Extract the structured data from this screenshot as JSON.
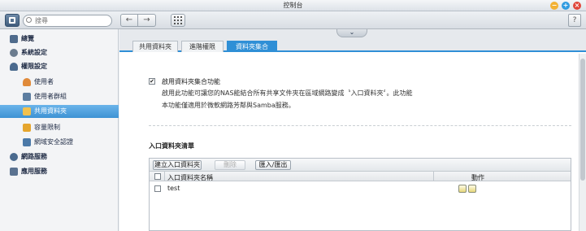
{
  "window": {
    "title": "控制台",
    "colors": {
      "minimize": "#f2b134",
      "maximize": "#2f9be0",
      "close": "#e0463a"
    }
  },
  "toolbar": {
    "search_placeholder": "搜尋",
    "back_icon": "←",
    "forward_icon": "→",
    "apps_icon": "grid-icon",
    "help_label": "?"
  },
  "sidebar": {
    "items": [
      {
        "label": "總覽",
        "icon": "overview-icon",
        "level": 1
      },
      {
        "label": "系統設定",
        "icon": "gear-icon",
        "level": 1
      },
      {
        "label": "權限設定",
        "icon": "user-icon",
        "level": 1
      },
      {
        "label": "使用者",
        "icon": "person-icon",
        "level": 2
      },
      {
        "label": "使用者群組",
        "icon": "group-icon",
        "level": 2
      },
      {
        "label": "共用資料夾",
        "icon": "folder-icon",
        "level": 2,
        "active": true
      },
      {
        "label": "容量限制",
        "icon": "quota-icon",
        "level": 2
      },
      {
        "label": "網域安全認證",
        "icon": "domain-icon",
        "level": 2
      },
      {
        "label": "網路服務",
        "icon": "globe-icon",
        "level": 1
      },
      {
        "label": "應用服務",
        "icon": "app-icon",
        "level": 1
      }
    ]
  },
  "tabs": [
    {
      "label": "共用資料夾"
    },
    {
      "label": "進階權限"
    },
    {
      "label": "資料夾集合",
      "active": true
    }
  ],
  "content": {
    "enable_label": "啟用資料夾集合功能",
    "enable_checked": true,
    "description_1": "啟用此功能可讓您的NAS能結合所有共享文件夾在區域網路變成〝入口資料夾〞。此功能",
    "description_2": "本功能僅適用於微軟網路芳鄰與Samba服務。",
    "list_title": "入口資料夾清單",
    "buttons": {
      "create": "建立入口資料夾",
      "delete": "刪除",
      "import_export": "匯入/匯出"
    },
    "columns": {
      "name": "入口資料夾名稱",
      "action": "動作"
    },
    "rows": [
      {
        "name": "test"
      }
    ]
  }
}
